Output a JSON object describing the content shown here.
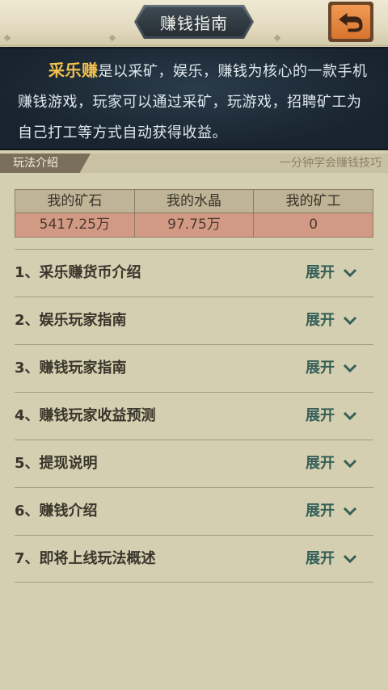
{
  "header": {
    "title": "赚钱指南",
    "back_icon": "undo-arrow-icon"
  },
  "intro": {
    "brand": "采乐赚",
    "text": "是以采矿，娱乐，赚钱为核心的一款手机赚钱游戏，玩家可以通过采矿，玩游戏，招聘矿工为自己打工等方式自动获得收益。"
  },
  "section": {
    "tab": "玩法介绍",
    "subtitle": "一分钟学会赚钱技巧"
  },
  "stats": {
    "headers": [
      "我的矿石",
      "我的水晶",
      "我的矿工"
    ],
    "values": [
      "5417.25万",
      "97.75万",
      "0"
    ]
  },
  "items": [
    {
      "title": "1、采乐赚货币介绍",
      "action": "展开"
    },
    {
      "title": "2、娱乐玩家指南",
      "action": "展开"
    },
    {
      "title": "3、赚钱玩家指南",
      "action": "展开"
    },
    {
      "title": "4、赚钱玩家收益预测",
      "action": "展开"
    },
    {
      "title": "5、提现说明",
      "action": "展开"
    },
    {
      "title": "6、赚钱介绍",
      "action": "展开"
    },
    {
      "title": "7、即将上线玩法概述",
      "action": "展开"
    }
  ],
  "colors": {
    "accent": "#f2c04c",
    "action": "#355f57",
    "back_button": "#e8853d"
  }
}
